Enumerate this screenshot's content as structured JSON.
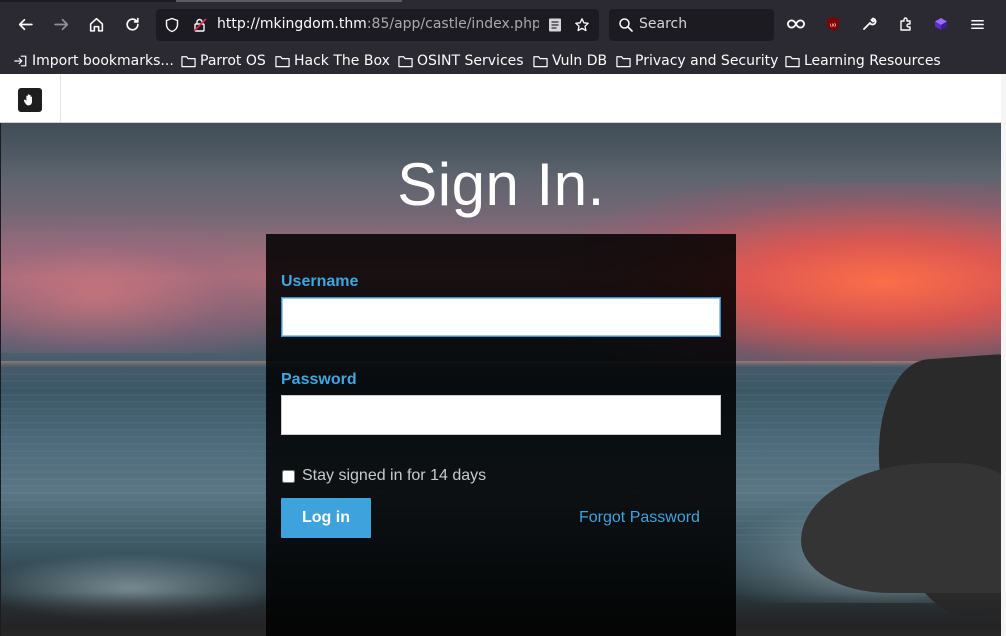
{
  "browser": {
    "url_host": "http://mkingdom.thm",
    "url_rest": ":85/app/castle/index.php",
    "search_placeholder": "Search"
  },
  "bookmarks": [
    {
      "label": "Import bookmarks...",
      "icon": "import-icon"
    },
    {
      "label": "Parrot OS",
      "icon": "folder-icon"
    },
    {
      "label": "Hack The Box",
      "icon": "folder-icon"
    },
    {
      "label": "OSINT Services",
      "icon": "folder-icon"
    },
    {
      "label": "Vuln DB",
      "icon": "folder-icon"
    },
    {
      "label": "Privacy and Security",
      "icon": "folder-icon"
    },
    {
      "label": "Learning Resources",
      "icon": "folder-icon"
    }
  ],
  "login": {
    "title": "Sign In.",
    "username_label": "Username",
    "username_value": "",
    "password_label": "Password",
    "password_value": "",
    "remember_label": "Stay signed in for 14 days",
    "remember_checked": false,
    "submit_label": "Log in",
    "forgot_label": "Forgot Password"
  },
  "colors": {
    "accent": "#3ea3dd",
    "label": "#3ea6e0",
    "browser_chrome": "#2b2a33",
    "urlbar": "#1c1b22"
  }
}
